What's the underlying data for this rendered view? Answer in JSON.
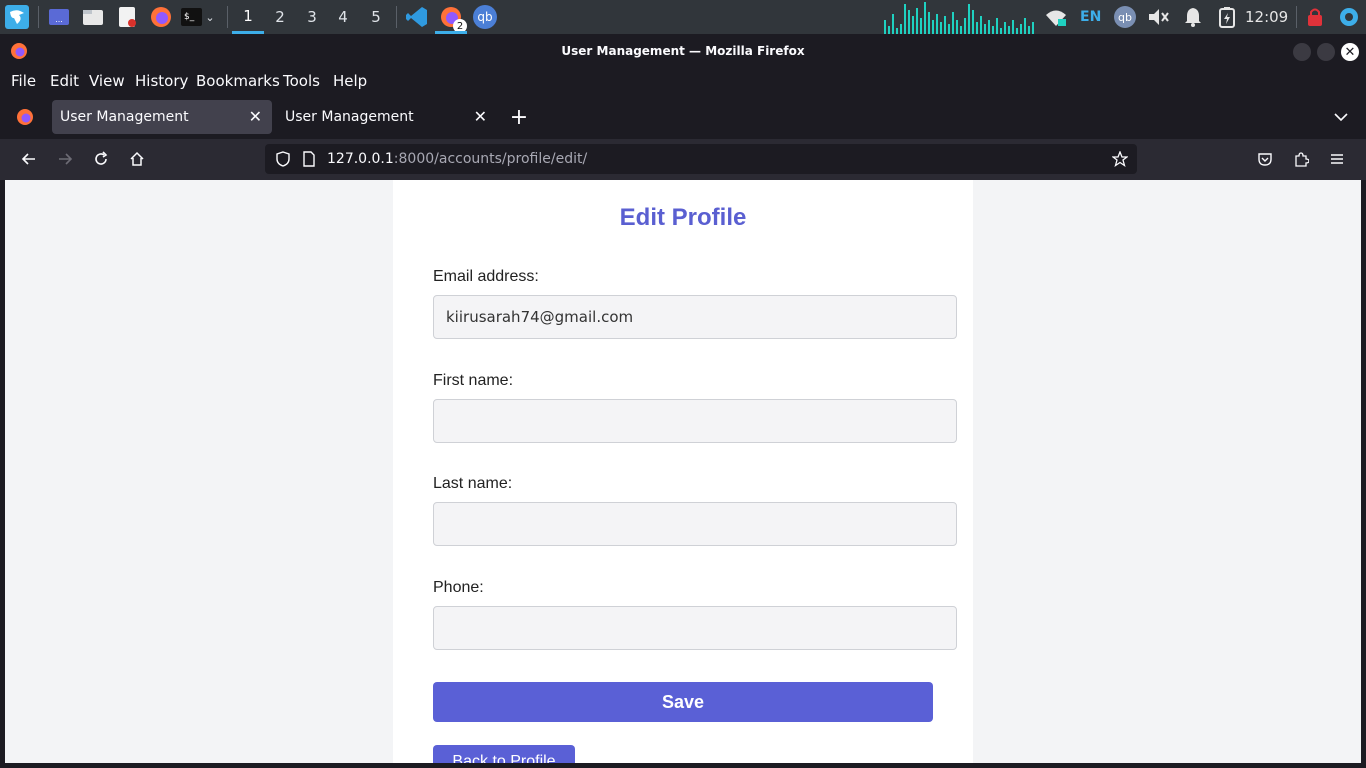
{
  "taskbar": {
    "workspaces": [
      "1",
      "2",
      "3",
      "4",
      "5"
    ],
    "active_workspace": "1",
    "language": "EN",
    "clock": "12:09",
    "firefox_badge": "2",
    "qb_label": "qb",
    "accent_color": "#3daee9"
  },
  "window": {
    "title": "User Management — Mozilla Firefox"
  },
  "menu": {
    "items": [
      "File",
      "Edit",
      "View",
      "History",
      "Bookmarks",
      "Tools",
      "Help"
    ]
  },
  "tabs": [
    {
      "label": "User Management",
      "active": true
    },
    {
      "label": "User Management",
      "active": false
    }
  ],
  "navbar": {
    "url_host": "127.0.0.1",
    "url_rest": ":8000/accounts/profile/edit/"
  },
  "page": {
    "title": "Edit Profile",
    "fields": [
      {
        "label": "Email address:",
        "value": "kiirusarah74@gmail.com"
      },
      {
        "label": "First name:",
        "value": ""
      },
      {
        "label": "Last name:",
        "value": ""
      },
      {
        "label": "Phone:",
        "value": ""
      }
    ],
    "save_label": "Save",
    "back_label": "Back to Profile",
    "accent_color": "#5a60d6"
  }
}
